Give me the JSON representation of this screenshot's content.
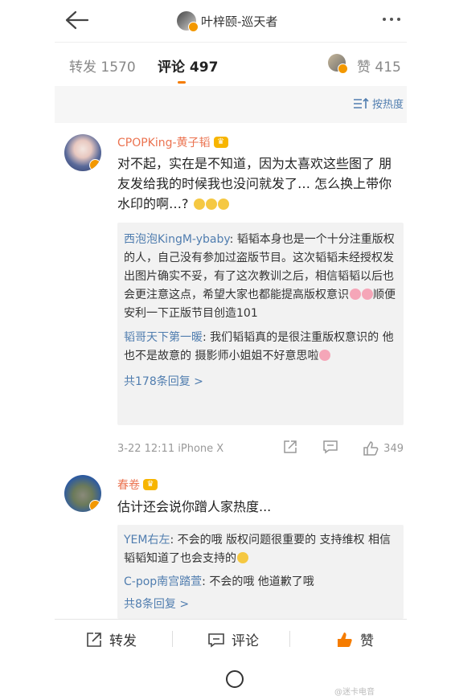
{
  "header": {
    "title": "叶梓颐-巡天者"
  },
  "tabs": {
    "repost_label": "转发",
    "repost_count": "1570",
    "comment_label": "评论",
    "comment_count": "497",
    "like_label": "赞",
    "like_count": "415"
  },
  "sort_label": "按热度",
  "comments": [
    {
      "user": "CPOPKing-黄子韬",
      "text": "对不起，实在是不知道，因为太喜欢这些图了 朋友发给我的时候我也没问就发了… 怎么换上带你水印的啊…?",
      "replies": [
        {
          "user": "西泡泡KingM-ybaby",
          "text": "韬韬本身也是一个十分注重版权的人，自己没有参加过盗版节目。这次韬韬未经授权发出图片确实不妥，有了这次教训之后，相信韬韬以后也会更注意这点，希望大家也都能提高版权意识",
          "text_after": "顺便安利一下正版节目创造101"
        },
        {
          "user": "韬哥天下第一暖",
          "text": "我们韬韬真的是很注重版权意识的 他也不是故意的 摄影师小姐姐不好意思啦"
        }
      ],
      "more_replies": "共178条回复 >",
      "time": "3-22 12:11",
      "device": "iPhone X",
      "likes": "349"
    },
    {
      "user": "春卷",
      "text": "估计还会说你蹭人家热度...",
      "replies": [
        {
          "user": "YEM右左",
          "text": "不会的哦 版权问题很重要的 支持维权 相信韬韬知道了也会支持的"
        },
        {
          "user": "C-pop南宫踏萱",
          "text": "不会的哦 他道歉了哦"
        }
      ],
      "more_replies": "共8条回复 >"
    }
  ],
  "bottom": {
    "repost": "转发",
    "comment": "评论",
    "like": "赞"
  },
  "watermark": "@迷卡电音",
  "colors": {
    "accent": "#f57c00",
    "link": "#507daf",
    "username": "#eb7350"
  }
}
